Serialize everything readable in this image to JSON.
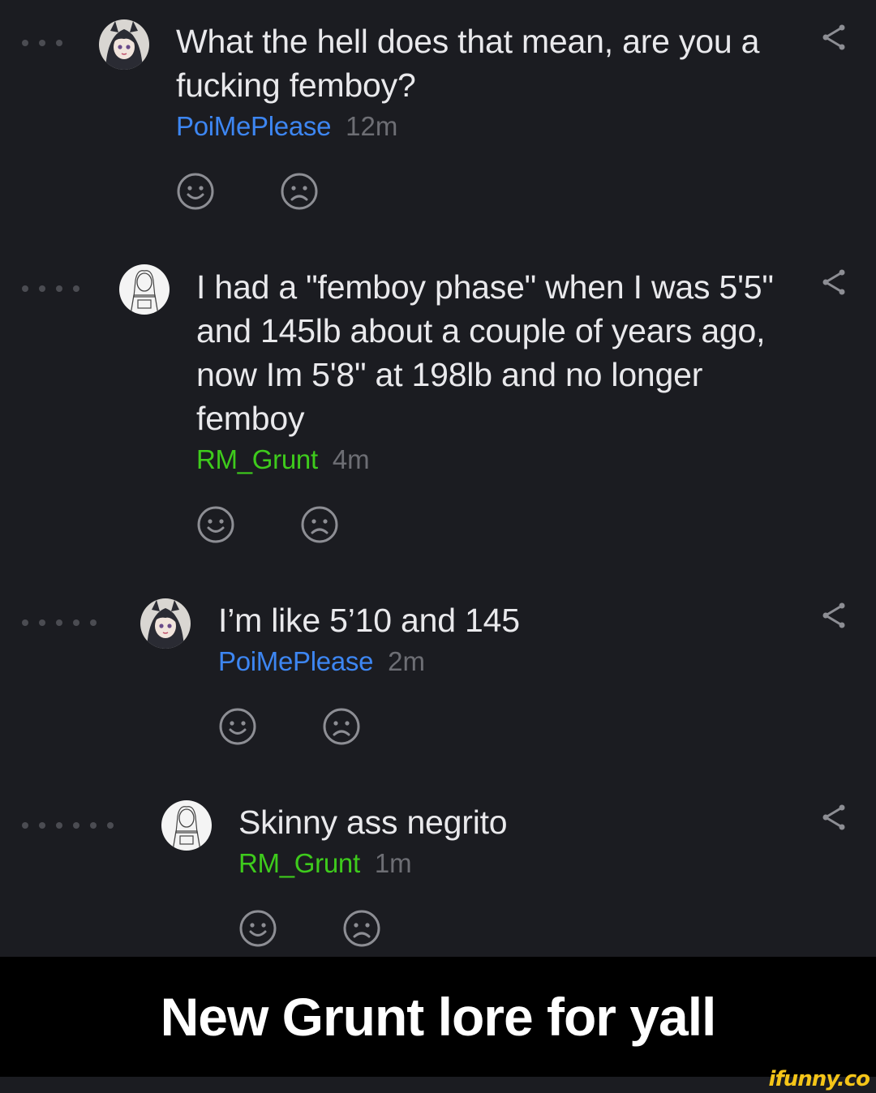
{
  "comments": [
    {
      "text": "What the hell does that mean, are you a fucking femboy?",
      "username": "PoiMePlease",
      "time": "12m",
      "avatar": "anime-girl-avatar"
    },
    {
      "text": "I had a \"femboy phase\" when I was 5'5\" and 145lb about a couple of years ago, now Im 5'8\" at 198lb and no longer femboy",
      "username": "RM_Grunt",
      "time": "4m",
      "avatar": "sketch-figure-avatar"
    },
    {
      "text": "I’m like 5’10 and 145",
      "username": "PoiMePlease",
      "time": "2m",
      "avatar": "anime-girl-avatar"
    },
    {
      "text": "Skinny ass negrito",
      "username": "RM_Grunt",
      "time": "1m",
      "avatar": "sketch-figure-avatar"
    }
  ],
  "caption": "New Grunt lore for yall",
  "watermark": "ifunny.co",
  "colors": {
    "background": "#1b1c21",
    "poi_username": "#3d86f2",
    "grunt_username": "#3ecb1c",
    "timestamp": "#6d6e74",
    "caption_bar": "#000000",
    "watermark": "#f5c518"
  }
}
